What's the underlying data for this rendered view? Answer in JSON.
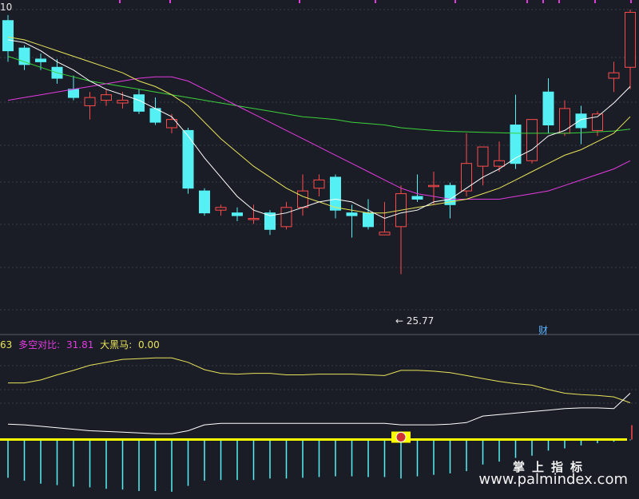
{
  "price_axis_top_label": "10",
  "indicator_header": {
    "first_value": "63",
    "duokong_label": "多空对比:",
    "duokong_value": "31.81",
    "heima_label": "大黑马:",
    "heima_value": "0.00"
  },
  "annotations": {
    "low_marker": "← 25.77",
    "finance_marker": "财"
  },
  "watermark": {
    "brand_cn": "掌上指标",
    "url": "www.palmindex.com"
  },
  "colors": {
    "background": "#1b1d26",
    "up_candle": "#ff4a4a",
    "down_candle": "#54f0f4",
    "ma5": "#ffffff",
    "ma10": "#e8e35a",
    "ma20": "#e23be0",
    "ma60": "#3bd23b",
    "grid": "#3a3d4a",
    "volume_bar": "#54f0f4",
    "baseline": "#ffff00",
    "heima_line": "#e8e35a",
    "duokong_line": "#ffffff"
  },
  "chart_data": {
    "type": "candlestick",
    "price_ylim": [
      24.3,
      35.4
    ],
    "candles": [
      {
        "o": 35.0,
        "h": 35.2,
        "l": 33.5,
        "c": 33.9
      },
      {
        "o": 34.0,
        "h": 34.1,
        "l": 33.2,
        "c": 33.4
      },
      {
        "o": 33.6,
        "h": 33.8,
        "l": 33.2,
        "c": 33.5
      },
      {
        "o": 33.3,
        "h": 33.6,
        "l": 32.7,
        "c": 32.9
      },
      {
        "o": 32.5,
        "h": 33.0,
        "l": 32.1,
        "c": 32.2
      },
      {
        "o": 31.9,
        "h": 32.4,
        "l": 31.4,
        "c": 32.2
      },
      {
        "o": 32.1,
        "h": 32.5,
        "l": 31.9,
        "c": 32.3
      },
      {
        "o": 32.0,
        "h": 32.4,
        "l": 31.8,
        "c": 32.1
      },
      {
        "o": 32.3,
        "h": 32.5,
        "l": 31.6,
        "c": 31.7
      },
      {
        "o": 31.8,
        "h": 32.2,
        "l": 31.2,
        "c": 31.3
      },
      {
        "o": 31.1,
        "h": 31.6,
        "l": 30.9,
        "c": 31.4
      },
      {
        "o": 31.0,
        "h": 31.1,
        "l": 28.7,
        "c": 28.9
      },
      {
        "o": 28.8,
        "h": 28.9,
        "l": 27.9,
        "c": 28.0
      },
      {
        "o": 28.1,
        "h": 28.3,
        "l": 27.9,
        "c": 28.2
      },
      {
        "o": 28.0,
        "h": 28.2,
        "l": 27.7,
        "c": 27.9
      },
      {
        "o": 27.8,
        "h": 28.3,
        "l": 27.6,
        "c": 27.8
      },
      {
        "o": 28.0,
        "h": 28.1,
        "l": 27.2,
        "c": 27.4
      },
      {
        "o": 27.5,
        "h": 28.4,
        "l": 27.4,
        "c": 28.2
      },
      {
        "o": 28.2,
        "h": 29.4,
        "l": 27.9,
        "c": 28.8
      },
      {
        "o": 28.9,
        "h": 29.4,
        "l": 28.6,
        "c": 29.2
      },
      {
        "o": 29.3,
        "h": 29.4,
        "l": 27.8,
        "c": 28.1
      },
      {
        "o": 28.0,
        "h": 28.3,
        "l": 27.1,
        "c": 27.9
      },
      {
        "o": 28.0,
        "h": 28.5,
        "l": 27.4,
        "c": 27.5
      },
      {
        "o": 27.2,
        "h": 28.4,
        "l": 27.2,
        "c": 27.3
      },
      {
        "o": 27.5,
        "h": 29.0,
        "l": 25.77,
        "c": 28.7
      },
      {
        "o": 28.6,
        "h": 29.4,
        "l": 28.4,
        "c": 28.5
      },
      {
        "o": 29.0,
        "h": 29.5,
        "l": 28.3,
        "c": 29.0
      },
      {
        "o": 29.0,
        "h": 29.1,
        "l": 27.8,
        "c": 28.3
      },
      {
        "o": 28.8,
        "h": 30.9,
        "l": 28.6,
        "c": 29.8
      },
      {
        "o": 29.7,
        "h": 30.4,
        "l": 29.0,
        "c": 30.4
      },
      {
        "o": 29.7,
        "h": 30.6,
        "l": 29.5,
        "c": 29.9
      },
      {
        "o": 31.2,
        "h": 32.3,
        "l": 29.6,
        "c": 29.8
      },
      {
        "o": 29.9,
        "h": 31.4,
        "l": 29.8,
        "c": 31.4
      },
      {
        "o": 32.4,
        "h": 32.9,
        "l": 30.9,
        "c": 31.2
      },
      {
        "o": 30.9,
        "h": 32.1,
        "l": 30.8,
        "c": 31.8
      },
      {
        "o": 31.6,
        "h": 31.9,
        "l": 30.5,
        "c": 31.1
      },
      {
        "o": 31.0,
        "h": 31.7,
        "l": 30.8,
        "c": 31.6
      },
      {
        "o": 32.9,
        "h": 33.5,
        "l": 32.4,
        "c": 33.1
      },
      {
        "o": 33.3,
        "h": 35.4,
        "l": 32.5,
        "c": 35.3
      }
    ],
    "ma5": [
      34.3,
      34.2,
      33.9,
      33.5,
      33.2,
      32.8,
      32.5,
      32.3,
      32.1,
      31.8,
      31.5,
      30.8,
      30.0,
      29.3,
      28.6,
      28.1,
      27.9,
      28.0,
      28.2,
      28.4,
      28.5,
      28.4,
      28.1,
      27.8,
      28.0,
      28.1,
      28.4,
      28.5,
      28.9,
      29.3,
      29.6,
      30.0,
      30.3,
      30.8,
      31.0,
      31.4,
      31.5,
      32.0,
      32.6
    ],
    "ma10": [
      34.4,
      34.3,
      34.1,
      33.9,
      33.7,
      33.5,
      33.3,
      33.1,
      32.8,
      32.6,
      32.3,
      31.9,
      31.3,
      30.7,
      30.2,
      29.7,
      29.3,
      28.9,
      28.6,
      28.4,
      28.2,
      28.1,
      28.0,
      28.0,
      28.1,
      28.2,
      28.3,
      28.4,
      28.5,
      28.7,
      28.9,
      29.2,
      29.5,
      29.8,
      30.1,
      30.3,
      30.6,
      30.9,
      31.5
    ],
    "ma20": [
      32.1,
      32.2,
      32.3,
      32.4,
      32.5,
      32.6,
      32.7,
      32.8,
      32.9,
      32.95,
      32.95,
      32.8,
      32.5,
      32.2,
      31.9,
      31.6,
      31.3,
      31.0,
      30.7,
      30.4,
      30.1,
      29.8,
      29.5,
      29.2,
      28.9,
      28.7,
      28.6,
      28.5,
      28.5,
      28.5,
      28.5,
      28.6,
      28.7,
      28.8,
      29.0,
      29.2,
      29.4,
      29.6,
      29.9
    ],
    "ma60": [
      33.7,
      33.5,
      33.3,
      33.1,
      32.95,
      32.8,
      32.7,
      32.6,
      32.5,
      32.4,
      32.3,
      32.2,
      32.1,
      32.0,
      31.9,
      31.8,
      31.7,
      31.6,
      31.5,
      31.45,
      31.4,
      31.3,
      31.25,
      31.2,
      31.1,
      31.05,
      31.0,
      30.97,
      30.95,
      30.93,
      30.92,
      30.9,
      30.9,
      30.9,
      30.9,
      30.92,
      30.95,
      30.98,
      31.05
    ],
    "indicator": {
      "ylim": [
        -7,
        12
      ],
      "heima": [
        7.7,
        7.7,
        8.1,
        8.8,
        9.4,
        10.1,
        10.5,
        10.9,
        11.0,
        11.1,
        11.1,
        10.5,
        9.5,
        9.0,
        8.9,
        9.0,
        9.0,
        8.8,
        8.8,
        8.9,
        8.9,
        8.9,
        8.8,
        8.7,
        9.4,
        9.4,
        9.3,
        9.1,
        8.7,
        8.3,
        7.9,
        7.6,
        7.4,
        6.8,
        6.3,
        6.1,
        6.0,
        5.8,
        5.0
      ],
      "duokong": [
        2.1,
        2.0,
        1.8,
        1.6,
        1.4,
        1.2,
        1.1,
        1.0,
        0.9,
        0.8,
        0.8,
        1.2,
        2.0,
        2.2,
        2.2,
        2.2,
        2.2,
        2.2,
        2.2,
        2.2,
        2.2,
        2.2,
        2.2,
        2.2,
        2.0,
        2.0,
        2.0,
        2.1,
        2.3,
        3.2,
        3.4,
        3.6,
        3.8,
        4.0,
        4.2,
        4.3,
        4.3,
        4.2,
        6.3
      ],
      "bars": [
        -5.2,
        -5.6,
        -6.0,
        -6.2,
        -6.4,
        -6.5,
        -6.7,
        -6.8,
        -7.0,
        -7.0,
        -7.1,
        -6.3,
        -5.6,
        -5.5,
        -5.5,
        -5.5,
        -5.3,
        -5.3,
        -5.2,
        -5.1,
        -5.0,
        -5.0,
        -5.1,
        -5.1,
        -5.3,
        -5.0,
        -4.8,
        -4.6,
        -4.3,
        -3.4,
        -3.0,
        -2.5,
        -2.2,
        -1.5,
        -1.2,
        -0.8,
        -0.5,
        -0.3,
        -0.1
      ],
      "signal_index": 24
    }
  }
}
